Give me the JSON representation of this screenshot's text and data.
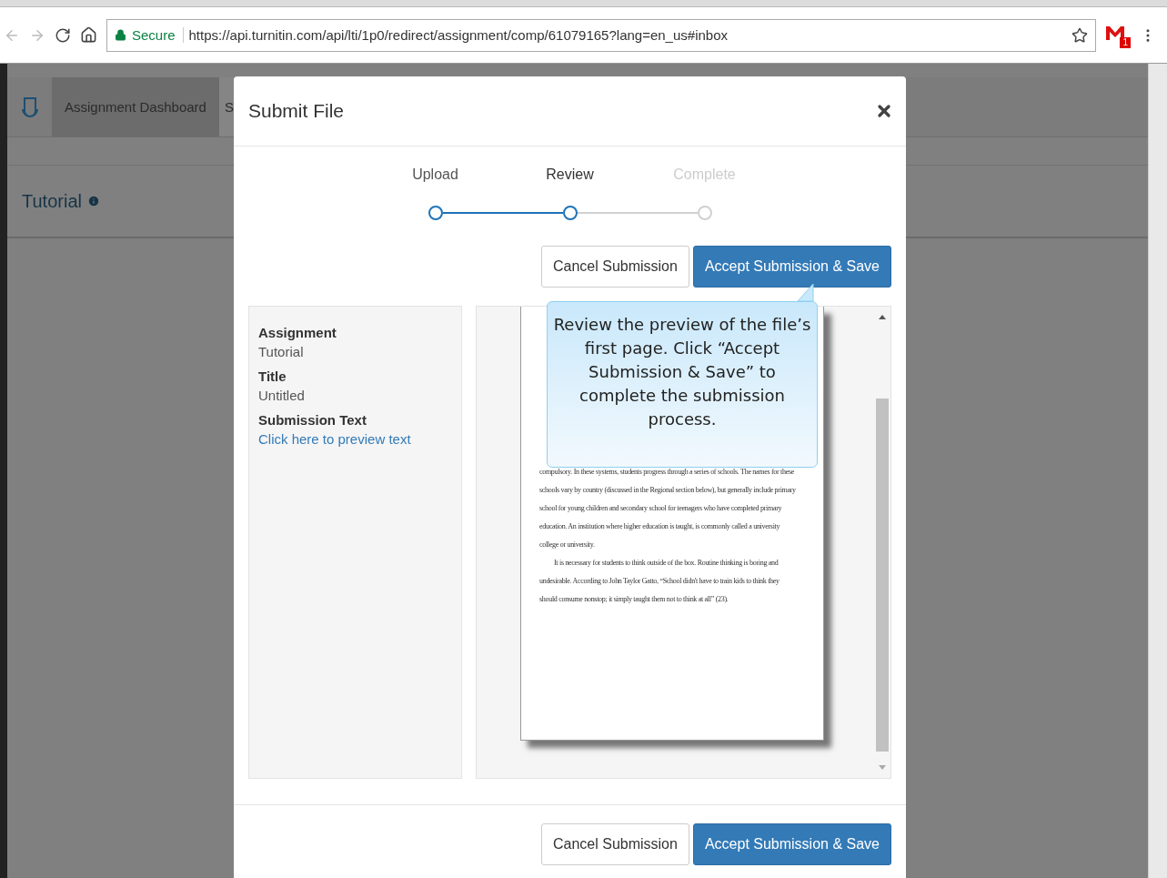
{
  "browser": {
    "secure_label": "Secure",
    "url": "https://api.turnitin.com/api/lti/1p0/redirect/assignment/comp/61079165?lang=en_us#inbox",
    "mail_count": "1"
  },
  "page": {
    "nav_tabs": [
      {
        "label": "Assignment Dashboard",
        "selected": true
      },
      {
        "label": "S",
        "selected": false
      }
    ],
    "heading": "Tutorial"
  },
  "modal": {
    "title": "Submit File",
    "steps": [
      {
        "label": "Upload",
        "done": true,
        "selected": false
      },
      {
        "label": "Review",
        "done": false,
        "selected": true
      },
      {
        "label": "Complete",
        "done": false,
        "selected": false
      }
    ],
    "top_buttons": [
      {
        "label": "Cancel Submission",
        "kind": "secondary"
      },
      {
        "label": "Accept Submission & Save",
        "kind": "primary"
      }
    ],
    "details": [
      {
        "label": "Assignment",
        "value": "Tutorial",
        "kind": "text"
      },
      {
        "label": "Title",
        "value": "Untitled",
        "kind": "text"
      },
      {
        "label": "Submission Text",
        "value": "Click here to preview text",
        "kind": "link"
      }
    ],
    "preview_paragraphs": [
      {
        "kind": "continued",
        "lines": [
          "compulsory. In these systems, students progress through a series of schools. The names for these",
          "schools vary by country (discussed in the Regional section below), but generally include primary",
          "school for young children and secondary school for teenagers who have completed primary",
          "education. An institution where higher education is taught, is commonly called a university",
          "college or university."
        ]
      },
      {
        "kind": "indented",
        "lines": [
          "It is necessary for students to think outside of the box. Routine thinking is boring and",
          "undesirable.  According to John Taylor Gatto, “School didn't have to train kids to think they",
          "should consume nonstop; it simply taught them not to think at all” (23)."
        ]
      }
    ],
    "tooltip": "Review the preview of the file’s first page. Click “Accept Submission & Save” to complete the submission process.",
    "footer_buttons": [
      {
        "label": "Cancel Submission",
        "kind": "secondary"
      },
      {
        "label": "Accept Submission & Save",
        "kind": "primary"
      }
    ]
  }
}
